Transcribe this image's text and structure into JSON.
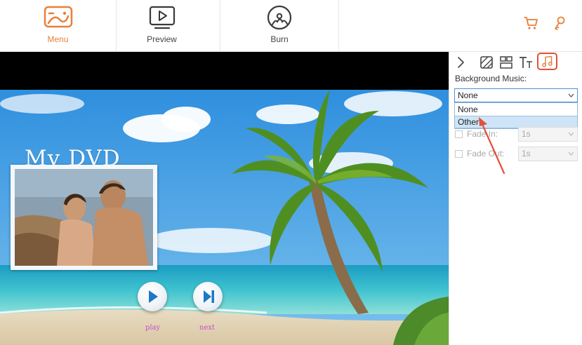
{
  "topbar": {
    "tabs": [
      {
        "label": "Menu",
        "icon": "menu-template-icon",
        "active": true
      },
      {
        "label": "Preview",
        "icon": "preview-play-icon",
        "active": false
      },
      {
        "label": "Burn",
        "icon": "burn-disc-icon",
        "active": false
      }
    ],
    "right_icons": [
      "cart-icon",
      "key-icon"
    ]
  },
  "preview": {
    "dvd_title": "My DVD",
    "buttons": [
      {
        "label": "play",
        "icon": "play-icon"
      },
      {
        "label": "next",
        "icon": "next-chapter-icon"
      }
    ]
  },
  "panel": {
    "tools": [
      "collapse-arrow-icon",
      "background-icon",
      "layout-icon",
      "text-icon",
      "music-icon"
    ],
    "background_music_label": "Background Music:",
    "select_value": "None",
    "options": [
      "None",
      "Other"
    ],
    "highlighted_option": "Other",
    "fade_in": {
      "label": "Fade In:",
      "value": "1s"
    },
    "fade_out": {
      "label": "Fade Out:",
      "value": "1s"
    }
  },
  "colors": {
    "accent": "#ea7f3a",
    "highlight_box": "#e2503a",
    "select_border": "#4a8fd6",
    "label_magenta": "#c94fc9"
  }
}
